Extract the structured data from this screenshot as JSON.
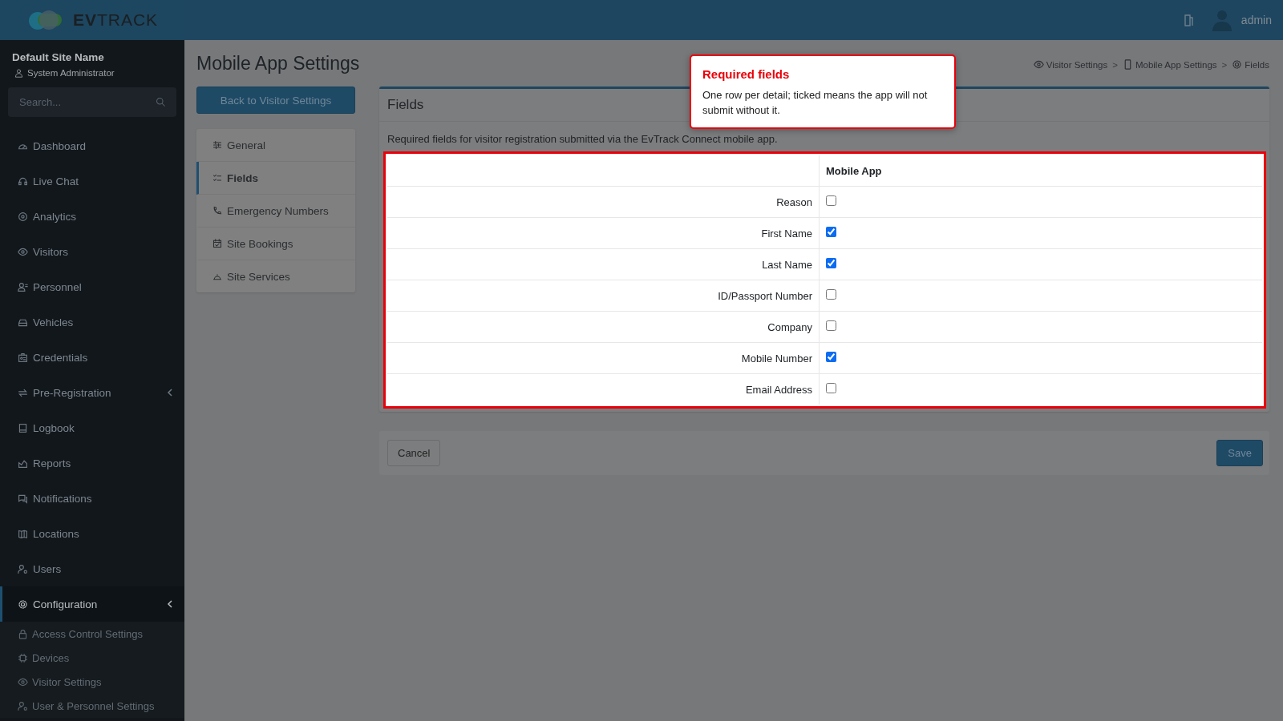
{
  "topbar": {
    "logo": "**EV**TRACK",
    "user": "admin"
  },
  "sidebar": {
    "site_name": "Default Site Name",
    "role": "System Administrator",
    "search": {
      "placeholder": "Search..."
    },
    "items": [
      {
        "label": "Dashboard",
        "selected": false,
        "has_submenu": false
      },
      {
        "label": "Live Chat",
        "selected": false,
        "has_submenu": false
      },
      {
        "label": "Analytics",
        "selected": false,
        "has_submenu": false
      },
      {
        "label": "Visitors",
        "selected": false,
        "has_submenu": false
      },
      {
        "label": "Personnel",
        "selected": false,
        "has_submenu": false
      },
      {
        "label": "Vehicles",
        "selected": false,
        "has_submenu": false
      },
      {
        "label": "Credentials",
        "selected": false,
        "has_submenu": false
      },
      {
        "label": "Pre-Registration",
        "selected": false,
        "has_submenu": true
      },
      {
        "label": "Logbook",
        "selected": false,
        "has_submenu": false
      },
      {
        "label": "Reports",
        "selected": false,
        "has_submenu": false
      },
      {
        "label": "Notifications",
        "selected": false,
        "has_submenu": false
      },
      {
        "label": "Locations",
        "selected": false,
        "has_submenu": false
      },
      {
        "label": "Users",
        "selected": false,
        "has_submenu": false
      },
      {
        "label": "Configuration",
        "selected": true,
        "has_submenu": true,
        "children": [
          {
            "label": "Access Control Settings"
          },
          {
            "label": "Devices"
          },
          {
            "label": "Visitor Settings"
          },
          {
            "label": "User & Personnel Settings"
          }
        ]
      }
    ]
  },
  "page": {
    "title": "Mobile App Settings",
    "back_button": "Back to Visitor Settings",
    "breadcrumb": [
      "Visitor Settings",
      "Mobile App Settings",
      "Fields"
    ],
    "breadcrumb_separator": ">",
    "nav": [
      {
        "label": "General",
        "selected": false
      },
      {
        "label": "Fields",
        "selected": true
      },
      {
        "label": "Emergency Numbers",
        "selected": false
      },
      {
        "label": "Site Bookings",
        "selected": false
      },
      {
        "label": "Site Services",
        "selected": false
      }
    ]
  },
  "card": {
    "title": "Fields",
    "description": "Required fields for visitor registration submitted via the EvTrack Connect mobile app.",
    "table": {
      "columns": [
        "Mobile App"
      ],
      "rows": [
        {
          "label": "Reason",
          "checked": false
        },
        {
          "label": "First Name",
          "checked": true
        },
        {
          "label": "Last Name",
          "checked": true
        },
        {
          "label": "ID/Passport Number",
          "checked": false
        },
        {
          "label": "Company",
          "checked": false
        },
        {
          "label": "Mobile Number",
          "checked": true
        },
        {
          "label": "Email Address",
          "checked": false
        }
      ]
    }
  },
  "tooltip": {
    "title": "Required fields",
    "text": "One row per detail; ticked means the app will not submit without it."
  },
  "footer": {
    "cancel": "Cancel",
    "save": "Save"
  }
}
